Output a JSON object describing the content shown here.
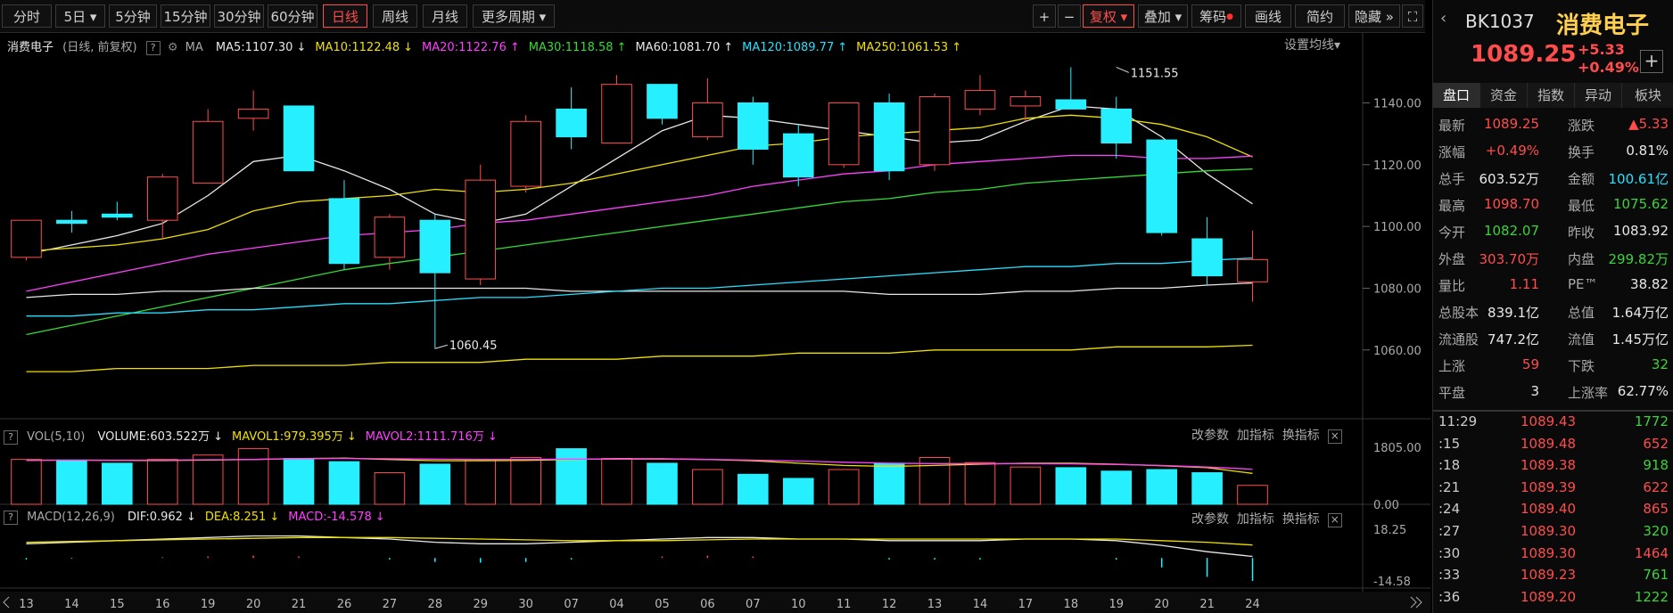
{
  "toolbar": {
    "periods": [
      "分时",
      "5日",
      "5分钟",
      "15分钟",
      "30分钟",
      "60分钟",
      "日线",
      "周线",
      "月线",
      "更多周期"
    ],
    "active_period": "日线",
    "right_buttons": [
      "+",
      "−",
      "复权",
      "叠加",
      "筹码",
      "画线",
      "简约",
      "隐藏"
    ]
  },
  "main_legend": {
    "name": "消费电子",
    "mode": "(日线, 前复权)",
    "ma_label": "MA",
    "items": [
      {
        "text": "MA5:1107.30",
        "arrow": "↓",
        "color": "#e8e8e8"
      },
      {
        "text": "MA10:1122.48",
        "arrow": "↓",
        "color": "#f0e000"
      },
      {
        "text": "MA20:1122.76",
        "arrow": "↑",
        "color": "#ff40ff"
      },
      {
        "text": "MA30:1118.58",
        "arrow": "↑",
        "color": "#33dd33"
      },
      {
        "text": "MA60:1081.70",
        "arrow": "↑",
        "color": "#e8e8e8"
      },
      {
        "text": "MA120:1089.77",
        "arrow": "↑",
        "color": "#26e0ff"
      },
      {
        "text": "MA250:1061.53",
        "arrow": "↑",
        "color": "#f0e000"
      }
    ],
    "setting": "设置均线"
  },
  "vol_legend": {
    "title": "VOL(5,10)",
    "items": [
      {
        "text": "VOLUME:603.522万",
        "arrow": "↓",
        "color": "#e8e8e8"
      },
      {
        "text": "MAVOL1:979.395万",
        "arrow": "↓",
        "color": "#f0e000"
      },
      {
        "text": "MAVOL2:1111.716万",
        "arrow": "↓",
        "color": "#ff40ff"
      }
    ]
  },
  "macd_legend": {
    "title": "MACD(12,26,9)",
    "items": [
      {
        "text": "DIF:0.962",
        "arrow": "↓",
        "color": "#e8e8e8"
      },
      {
        "text": "DEA:8.251",
        "arrow": "↓",
        "color": "#f0e000"
      },
      {
        "text": "MACD:-14.578",
        "arrow": "↓",
        "color": "#ff40ff"
      }
    ]
  },
  "sub_links": [
    "改参数",
    "加指标",
    "换指标"
  ],
  "right_panel": {
    "code": "BK1037",
    "name": "消费电子",
    "price": "1089.25",
    "change": "+5.33",
    "change_pct": "+0.49%",
    "tabs": [
      "盘口",
      "资金",
      "指数",
      "异动",
      "板块"
    ],
    "quote_rows": [
      {
        "l1": "最新",
        "v1": "1089.25",
        "c1": "#ff4d4d",
        "l2": "涨跌",
        "v2": "▲5.33",
        "c2": "#ff4d4d"
      },
      {
        "l1": "涨幅",
        "v1": "+0.49%",
        "c1": "#ff4d4d",
        "l2": "换手",
        "v2": "0.81%",
        "c2": "#e8e8e8"
      },
      {
        "l1": "总手",
        "v1": "603.52万",
        "c1": "#e8e8e8",
        "l2": "金额",
        "v2": "100.61亿",
        "c2": "#26e0ff"
      },
      {
        "l1": "最高",
        "v1": "1098.70",
        "c1": "#ff4d4d",
        "l2": "最低",
        "v2": "1075.62",
        "c2": "#3ed13e"
      },
      {
        "l1": "今开",
        "v1": "1082.07",
        "c1": "#3ed13e",
        "l2": "昨收",
        "v2": "1083.92",
        "c2": "#e8e8e8"
      },
      {
        "l1": "外盘",
        "v1": "303.70万",
        "c1": "#ff4d4d",
        "l2": "内盘",
        "v2": "299.82万",
        "c2": "#3ed13e"
      },
      {
        "l1": "量比",
        "v1": "1.11",
        "c1": "#ff4d4d",
        "l2": "PE™",
        "v2": "38.82",
        "c2": "#e8e8e8"
      },
      {
        "l1": "总股本",
        "v1": "839.1亿",
        "c1": "#e8e8e8",
        "l2": "总值",
        "v2": "1.64万亿",
        "c2": "#e8e8e8"
      },
      {
        "l1": "流通股",
        "v1": "747.2亿",
        "c1": "#e8e8e8",
        "l2": "流值",
        "v2": "1.45万亿",
        "c2": "#e8e8e8"
      },
      {
        "l1": "上涨",
        "v1": "59",
        "c1": "#ff4d4d",
        "l2": "下跌",
        "v2": "32",
        "c2": "#3ed13e"
      },
      {
        "l1": "平盘",
        "v1": "3",
        "c1": "#e8e8e8",
        "l2": "上涨率",
        "v2": "62.77%",
        "c2": "#e8e8e8"
      }
    ],
    "ticks": [
      {
        "t": "11:29",
        "p": "1089.43",
        "v": "1772",
        "c": "#3ed13e"
      },
      {
        "t": ":15",
        "p": "1089.48",
        "v": "652",
        "c": "#ff4d4d"
      },
      {
        "t": ":18",
        "p": "1089.38",
        "v": "918",
        "c": "#3ed13e"
      },
      {
        "t": ":21",
        "p": "1089.39",
        "v": "622",
        "c": "#ff4d4d"
      },
      {
        "t": ":24",
        "p": "1089.40",
        "v": "865",
        "c": "#ff4d4d"
      },
      {
        "t": ":27",
        "p": "1089.30",
        "v": "320",
        "c": "#3ed13e"
      },
      {
        "t": ":30",
        "p": "1089.30",
        "v": "1464",
        "c": "#ff4d4d"
      },
      {
        "t": ":33",
        "p": "1089.23",
        "v": "761",
        "c": "#3ed13e"
      },
      {
        "t": ":36",
        "p": "1089.20",
        "v": "1222",
        "c": "#3ed13e"
      }
    ]
  },
  "chart_data": {
    "type": "candlestick",
    "title": "消费电子",
    "price_axis": {
      "ticks": [
        1140,
        1120,
        1100,
        1080,
        1060
      ],
      "labels": [
        "1140.00",
        "1120.00",
        "1100.00",
        "1080.00",
        "1060.00"
      ],
      "ylim": [
        1036,
        1156
      ]
    },
    "vol_axis": {
      "labels": [
        "1805.00",
        "0.00"
      ],
      "ylim": [
        0,
        1805
      ]
    },
    "macd_axis": {
      "labels": [
        "18.25",
        "-14.58"
      ],
      "ylim": [
        -14.58,
        18.25
      ]
    },
    "annotations": [
      {
        "text": "1151.55",
        "index": 24,
        "value": 1151.55,
        "side": "high"
      },
      {
        "text": "1060.45",
        "index": 9,
        "value": 1060.45,
        "side": "low"
      }
    ],
    "x_labels": [
      "13",
      "14",
      "15",
      "16",
      "19",
      "20",
      "21",
      "26",
      "27",
      "28",
      "29",
      "30",
      "07",
      "04",
      "05",
      "06",
      "07",
      "10",
      "11",
      "12",
      "13",
      "14",
      "17",
      "18",
      "19",
      "20",
      "21",
      "24"
    ],
    "candles": [
      {
        "o": 1090,
        "h": 1098,
        "l": 1089,
        "c": 1102
      },
      {
        "o": 1102,
        "h": 1105,
        "l": 1098,
        "c": 1101
      },
      {
        "o": 1104,
        "h": 1108,
        "l": 1102,
        "c": 1103
      },
      {
        "o": 1102,
        "h": 1117,
        "l": 1096,
        "c": 1116
      },
      {
        "o": 1114,
        "h": 1138,
        "l": 1114,
        "c": 1134
      },
      {
        "o": 1135,
        "h": 1144,
        "l": 1131,
        "c": 1138
      },
      {
        "o": 1139,
        "h": 1139,
        "l": 1118,
        "c": 1118
      },
      {
        "o": 1109,
        "h": 1115,
        "l": 1086,
        "c": 1088
      },
      {
        "o": 1090,
        "h": 1104,
        "l": 1086,
        "c": 1103
      },
      {
        "o": 1102,
        "h": 1104,
        "l": 1060.45,
        "c": 1085
      },
      {
        "o": 1083,
        "h": 1120,
        "l": 1081,
        "c": 1115
      },
      {
        "o": 1113,
        "h": 1136,
        "l": 1111,
        "c": 1134
      },
      {
        "o": 1138,
        "h": 1145,
        "l": 1125,
        "c": 1129
      },
      {
        "o": 1127,
        "h": 1149,
        "l": 1127,
        "c": 1146
      },
      {
        "o": 1146,
        "h": 1146,
        "l": 1133,
        "c": 1135
      },
      {
        "o": 1129,
        "h": 1148,
        "l": 1128,
        "c": 1140
      },
      {
        "o": 1140,
        "h": 1142,
        "l": 1120,
        "c": 1125
      },
      {
        "o": 1130,
        "h": 1133,
        "l": 1113,
        "c": 1116
      },
      {
        "o": 1120,
        "h": 1140,
        "l": 1119,
        "c": 1140
      },
      {
        "o": 1140,
        "h": 1143,
        "l": 1115,
        "c": 1118
      },
      {
        "o": 1120,
        "h": 1143,
        "l": 1118,
        "c": 1142
      },
      {
        "o": 1138,
        "h": 1149,
        "l": 1136,
        "c": 1144
      },
      {
        "o": 1139,
        "h": 1144,
        "l": 1134,
        "c": 1142
      },
      {
        "o": 1141,
        "h": 1151.55,
        "l": 1138,
        "c": 1138
      },
      {
        "o": 1138,
        "h": 1142,
        "l": 1122,
        "c": 1127
      },
      {
        "o": 1128,
        "h": 1128,
        "l": 1097,
        "c": 1098
      },
      {
        "o": 1096,
        "h": 1103,
        "l": 1081,
        "c": 1084
      },
      {
        "o": 1082.07,
        "h": 1098.7,
        "l": 1075.62,
        "c": 1089.25
      }
    ],
    "volume": [
      1420,
      1400,
      1300,
      1420,
      1560,
      1760,
      1450,
      1350,
      1000,
      1270,
      1420,
      1480,
      1760,
      1450,
      1300,
      1100,
      950,
      820,
      1100,
      1300,
      1480,
      1320,
      1180,
      1160,
      1050,
      1100,
      1000,
      600
    ],
    "ma": [
      {
        "name": "MA5",
        "color": "#e8e8e8",
        "values": [
          1091,
          1094,
          1097,
          1101,
          1110,
          1121,
          1123,
          1118,
          1112,
          1104,
          1101,
          1104,
          1113,
          1122,
          1131,
          1136,
          1135,
          1133,
          1131,
          1129,
          1127,
          1128,
          1134,
          1139,
          1138,
          1129,
          1117,
          1107.3
        ]
      },
      {
        "name": "MA10",
        "color": "#f0e000",
        "values": [
          1092,
          1093,
          1094,
          1096,
          1099,
          1105,
          1108,
          1109,
          1110,
          1112,
          1111,
          1112,
          1114,
          1117,
          1120,
          1123,
          1126,
          1127,
          1129,
          1130,
          1131,
          1132,
          1135,
          1136,
          1135,
          1133,
          1129,
          1122.48
        ]
      },
      {
        "name": "MA20",
        "color": "#ff40ff",
        "values": [
          1079,
          1082,
          1085,
          1088,
          1091,
          1093,
          1095,
          1097,
          1098,
          1099,
          1101,
          1102,
          1104,
          1106,
          1108,
          1110,
          1113,
          1115,
          1117,
          1118,
          1120,
          1121,
          1122,
          1123,
          1123,
          1122,
          1122,
          1122.76
        ]
      },
      {
        "name": "MA30",
        "color": "#33dd33",
        "values": [
          1065,
          1068,
          1071,
          1074,
          1077,
          1080,
          1083,
          1086,
          1088,
          1090,
          1092,
          1094,
          1096,
          1098,
          1100,
          1102,
          1104,
          1106,
          1108,
          1109,
          1111,
          1112,
          1114,
          1115,
          1116,
          1117,
          1118,
          1118.58
        ]
      },
      {
        "name": "MA60",
        "color": "#e8e8e8",
        "values": [
          1077,
          1078,
          1078,
          1079,
          1079,
          1080,
          1080,
          1080,
          1080,
          1080,
          1080,
          1080,
          1079,
          1079,
          1079,
          1079,
          1079,
          1079,
          1079,
          1078,
          1078,
          1078,
          1079,
          1079,
          1080,
          1080,
          1081,
          1081.7
        ]
      },
      {
        "name": "MA120",
        "color": "#26e0ff",
        "values": [
          1071,
          1071,
          1072,
          1072,
          1073,
          1073,
          1074,
          1075,
          1075,
          1076,
          1077,
          1077,
          1078,
          1079,
          1080,
          1080,
          1081,
          1082,
          1083,
          1084,
          1085,
          1086,
          1087,
          1087,
          1088,
          1088,
          1089,
          1089.77
        ]
      },
      {
        "name": "MA250",
        "color": "#f0e000",
        "values": [
          1053,
          1053,
          1054,
          1054,
          1054,
          1055,
          1055,
          1055,
          1056,
          1056,
          1056,
          1057,
          1057,
          1057,
          1058,
          1058,
          1058,
          1059,
          1059,
          1059,
          1060,
          1060,
          1060,
          1060,
          1061,
          1061,
          1061,
          1061.53
        ]
      }
    ],
    "mavol": [
      {
        "name": "MAVOL1",
        "color": "#f0e000",
        "values": [
          1390,
          1395,
          1390,
          1385,
          1400,
          1420,
          1450,
          1460,
          1420,
          1380,
          1380,
          1390,
          1420,
          1440,
          1440,
          1420,
          1380,
          1300,
          1230,
          1200,
          1230,
          1270,
          1300,
          1300,
          1270,
          1220,
          1160,
          979.4
        ]
      },
      {
        "name": "MAVOL2",
        "color": "#ff40ff",
        "values": [
          1400,
          1400,
          1400,
          1400,
          1410,
          1420,
          1440,
          1450,
          1440,
          1430,
          1420,
          1420,
          1430,
          1430,
          1430,
          1420,
          1400,
          1370,
          1330,
          1300,
          1290,
          1290,
          1290,
          1280,
          1260,
          1230,
          1180,
          1111.7
        ]
      }
    ],
    "macd": {
      "dif": [
        9,
        10,
        11,
        12,
        13,
        14,
        14,
        13,
        12,
        10,
        9,
        9,
        10,
        11,
        12,
        13,
        13,
        12,
        12,
        11,
        11,
        11,
        12,
        12,
        11,
        8,
        4,
        0.96
      ],
      "dea": [
        10,
        10.5,
        11,
        11.5,
        12,
        12.5,
        13,
        13,
        13,
        12.5,
        12,
        11.5,
        11,
        11,
        11,
        11.5,
        12,
        12,
        12,
        12,
        12,
        12,
        12,
        12,
        12,
        11,
        10,
        8.25
      ],
      "hist": [
        -1,
        -0.5,
        0,
        0.5,
        1,
        1.5,
        1,
        0,
        -1,
        -2.5,
        -3,
        -2.5,
        -1,
        0,
        1,
        1.5,
        1,
        0,
        0,
        -1,
        -1,
        -1,
        0,
        0,
        -1,
        -6,
        -12,
        -14.58
      ]
    }
  }
}
